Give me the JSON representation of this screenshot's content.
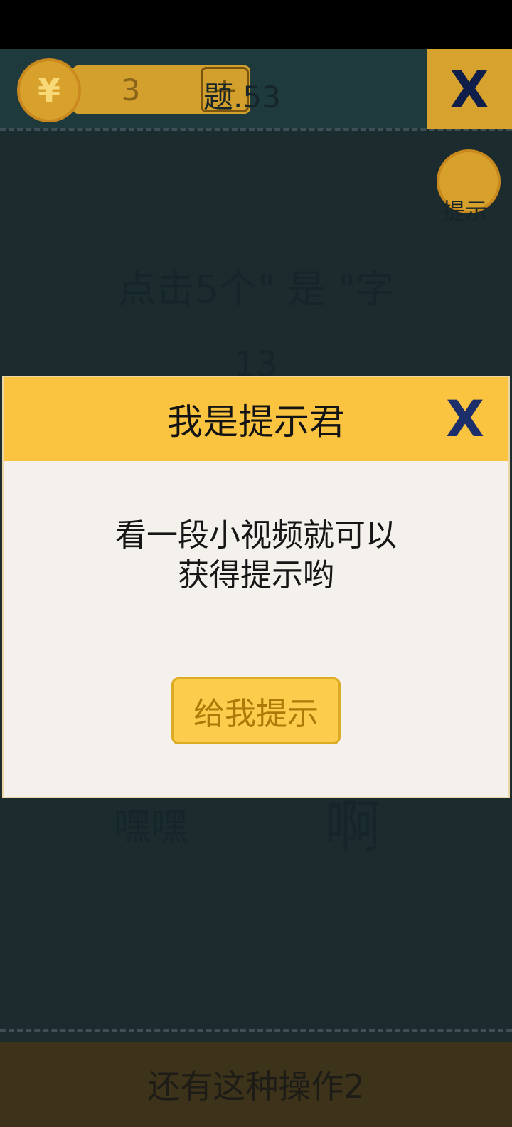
{
  "game": {
    "coins": "3",
    "plus_symbol": "+",
    "level": "题.53",
    "close_symbol": "X",
    "hint_label": "提示",
    "question": "点击5个\" 是 \"字",
    "counter": "13",
    "words": [
      "嘿嘿",
      "啊"
    ],
    "bottom_text": "还有这种操作2",
    "currency_symbol": "¥"
  },
  "modal": {
    "title": "我是提示君",
    "close_symbol": "X",
    "message_line1": "看一段小视频就可以",
    "message_line2": "获得提示哟",
    "button_label": "给我提示"
  },
  "colors": {
    "overlay_bg": "#1b2b2e",
    "modal_header": "#fbc440",
    "modal_body": "#f4f1ec",
    "button_bg": "#fccd4c",
    "button_text": "#ad7a08",
    "close_x": "#1d2f6a"
  }
}
